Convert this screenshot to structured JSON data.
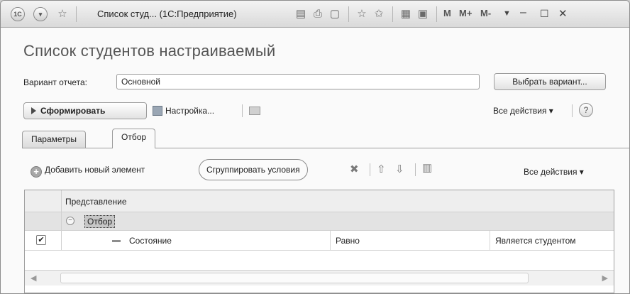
{
  "titlebar": {
    "app_logo": "1С",
    "title": "Список студ... (1С:Предприятие)",
    "m1": "M",
    "m2": "M+",
    "m3": "M-"
  },
  "form": {
    "title": "Список студентов настраиваемый",
    "variant_label": "Вариант отчета:",
    "variant_value": "Основной",
    "choose_variant_button": "Выбрать вариант..."
  },
  "command_bar": {
    "generate_button": "Сформировать",
    "settings_button": "Настройка...",
    "all_actions": "Все действия",
    "help": "?"
  },
  "tabs": [
    {
      "label": "Параметры",
      "active": false
    },
    {
      "label": "Отбор",
      "active": true
    }
  ],
  "filter_toolbar": {
    "add_button": "Добавить новый элемент",
    "group_button": "Сгруппировать условия",
    "all_actions": "Все действия"
  },
  "table": {
    "header": "Представление",
    "group_row": "Отбор",
    "rows": [
      {
        "checked": true,
        "field": "Состояние",
        "comparison": "Равно",
        "value": "Является студентом"
      }
    ]
  }
}
